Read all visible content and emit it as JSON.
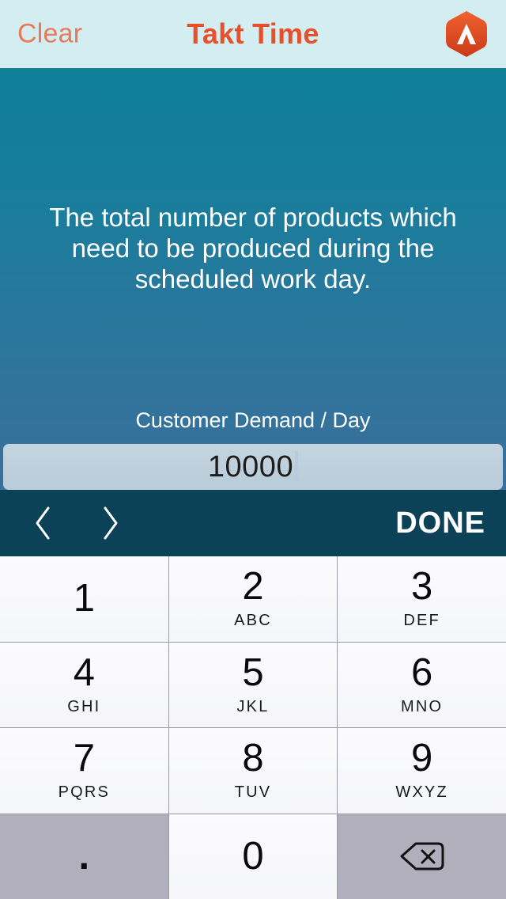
{
  "header": {
    "clear_label": "Clear",
    "title": "Takt Time",
    "logo_icon": "hexagon-lambda-logo",
    "bg_color": "#d4edf0",
    "title_color": "#e8502a",
    "clear_color": "#e8795a"
  },
  "content": {
    "description": "The total number of products which need to be produced during the scheduled work day.",
    "gradient_top": "#0d7f99",
    "gradient_bottom": "#3a709a"
  },
  "field": {
    "label": "Customer Demand / Day",
    "value": "10000",
    "placeholder": "",
    "bg_color": "#c0d0de"
  },
  "toolbar": {
    "prev_icon": "chevron-left-icon",
    "next_icon": "chevron-right-icon",
    "done_label": "DONE",
    "bg_color": "#0c4258"
  },
  "keypad": {
    "keys": [
      {
        "digit": "1",
        "letters": "",
        "style": "light"
      },
      {
        "digit": "2",
        "letters": "ABC",
        "style": "light"
      },
      {
        "digit": "3",
        "letters": "DEF",
        "style": "light"
      },
      {
        "digit": "4",
        "letters": "GHI",
        "style": "light"
      },
      {
        "digit": "5",
        "letters": "JKL",
        "style": "light"
      },
      {
        "digit": "6",
        "letters": "MNO",
        "style": "light"
      },
      {
        "digit": "7",
        "letters": "PQRS",
        "style": "light"
      },
      {
        "digit": "8",
        "letters": "TUV",
        "style": "light"
      },
      {
        "digit": "9",
        "letters": "WXYZ",
        "style": "light"
      },
      {
        "digit": ".",
        "letters": "",
        "style": "dim"
      },
      {
        "digit": "0",
        "letters": "",
        "style": "light"
      },
      {
        "digit": "",
        "letters": "",
        "style": "dim",
        "icon": "backspace-icon"
      }
    ]
  }
}
